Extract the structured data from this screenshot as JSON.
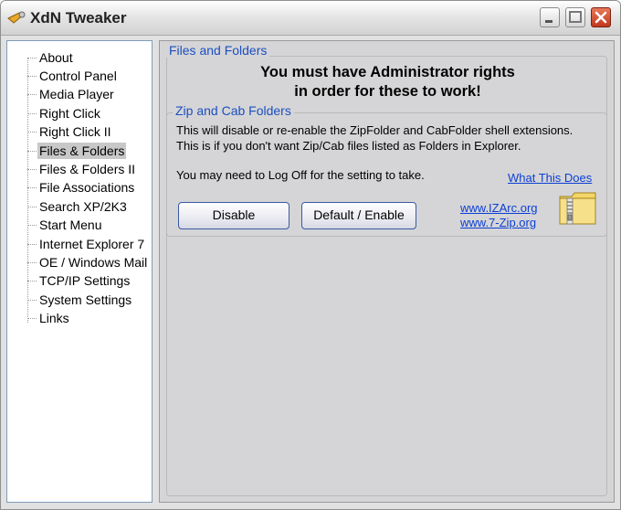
{
  "window": {
    "title": "XdN Tweaker"
  },
  "tree": {
    "items": [
      {
        "label": "About"
      },
      {
        "label": "Control Panel"
      },
      {
        "label": "Media Player"
      },
      {
        "label": "Right Click"
      },
      {
        "label": "Right Click II"
      },
      {
        "label": "Files & Folders",
        "selected": true
      },
      {
        "label": "Files & Folders II"
      },
      {
        "label": "File Associations"
      },
      {
        "label": "Search XP/2K3"
      },
      {
        "label": "Start Menu"
      },
      {
        "label": "Internet Explorer 7"
      },
      {
        "label": "OE / Windows Mail"
      },
      {
        "label": "TCP/IP Settings"
      },
      {
        "label": "System Settings"
      },
      {
        "label": "Links"
      }
    ]
  },
  "panel": {
    "group_title": "Files and Folders",
    "admin_line1": "You must have Administrator rights",
    "admin_line2": "in order for these to work!",
    "zip_group": {
      "title": "Zip and Cab Folders",
      "desc1": "This will disable or re-enable the ZipFolder and CabFolder shell extensions.",
      "desc2": "This is if you don't want Zip/Cab files listed as Folders in Explorer.",
      "logoff": "You may need to Log Off for the setting to take.",
      "what_link": "What This Does",
      "disable_label": "Disable",
      "enable_label": "Default / Enable",
      "izarc_link": "www.IZArc.org",
      "sevenzip_link": "www.7-Zip.org"
    }
  },
  "colors": {
    "link": "#0b3fd6",
    "legend": "#1c4fbf"
  }
}
